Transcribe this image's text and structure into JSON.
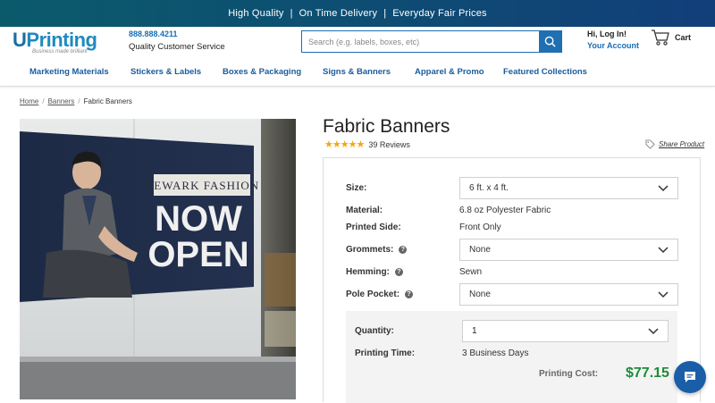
{
  "promo": {
    "items": [
      "High Quality",
      "On Time Delivery",
      "Everyday Fair Prices"
    ],
    "separator": "|"
  },
  "header": {
    "logo_text": "UPrinting",
    "logo_tagline": "Business made brilliant",
    "phone": "888.888.4211",
    "service": "Quality Customer Service",
    "search_placeholder": "Search (e.g. labels, boxes, etc)",
    "greeting": "Hi, Log In!",
    "account": "Your Account",
    "cart": "Cart"
  },
  "nav": {
    "items": [
      "Marketing Materials",
      "Stickers & Labels",
      "Boxes & Packaging",
      "Signs & Banners",
      "Apparel & Promo",
      "Featured Collections"
    ]
  },
  "breadcrumb": {
    "home": "Home",
    "banners": "Banners",
    "current": "Fabric Banners",
    "separator": "/"
  },
  "hero": {
    "banner_small": "NEWARK FASHION",
    "banner_line1": "NOW",
    "banner_line2": "OPEN"
  },
  "product": {
    "title": "Fabric Banners",
    "rating": 4.5,
    "stars": "★★★★★",
    "reviews": "39 Reviews",
    "share": "Share Product"
  },
  "config": {
    "size_label": "Size:",
    "size_value": "6 ft. x 4 ft.",
    "material_label": "Material:",
    "material_value": "6.8 oz Polyester Fabric",
    "side_label": "Printed Side:",
    "side_value": "Front Only",
    "grommets_label": "Grommets:",
    "grommets_value": "None",
    "hemming_label": "Hemming:",
    "hemming_value": "Sewn",
    "pole_label": "Pole Pocket:",
    "pole_value": "None",
    "help_glyph": "?",
    "quantity_label": "Quantity:",
    "quantity_value": "1",
    "printing_time_label": "Printing Time:",
    "printing_time_value": "3 Business Days",
    "printing_cost_label": "Printing Cost:",
    "printing_cost_value": "$77.15"
  },
  "colors": {
    "brand_blue": "#1a6db4",
    "price_green": "#1f8a3a",
    "star": "#f2a618"
  }
}
